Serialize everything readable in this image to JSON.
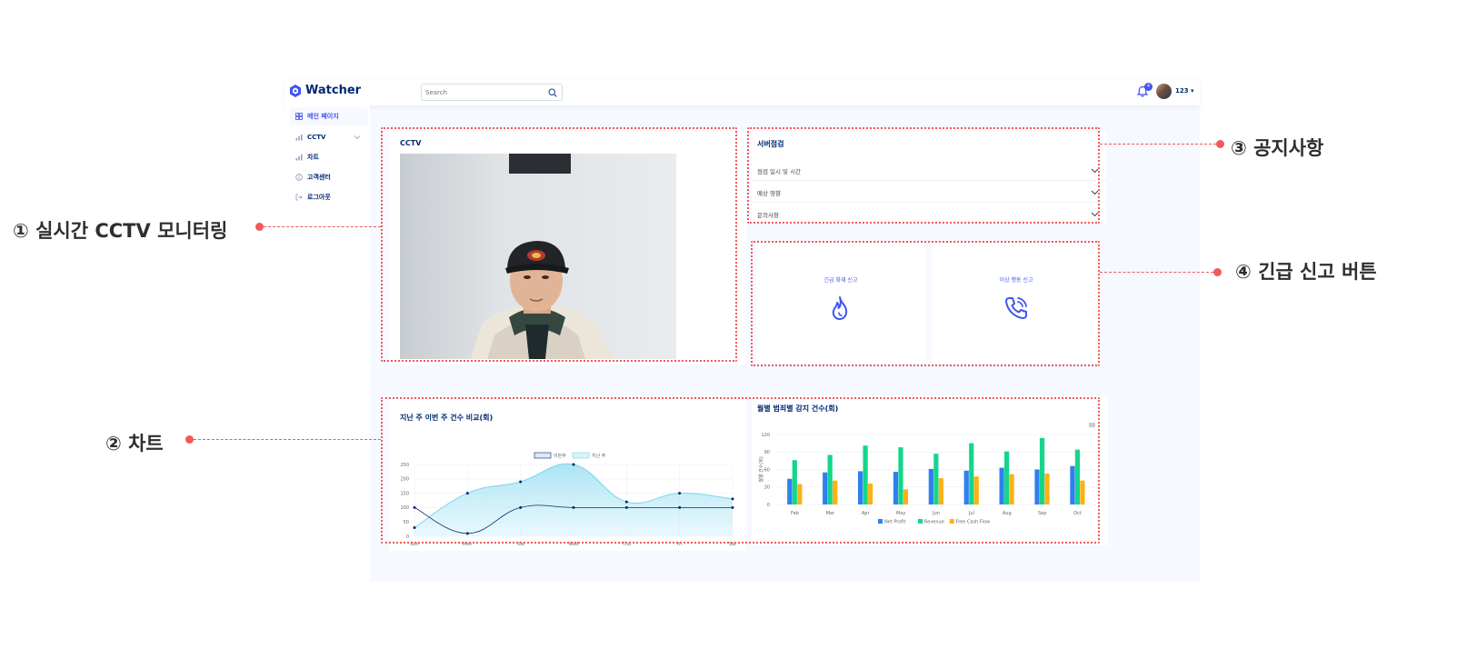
{
  "app": {
    "name": "Watcher",
    "search_placeholder": "Search",
    "notification_count": "4",
    "user_name": "123 ▾"
  },
  "sidebar": {
    "items": [
      {
        "label": "메인 페이지",
        "icon": "grid-icon",
        "active": true
      },
      {
        "label": "CCTV",
        "icon": "bar-chart-icon",
        "expandable": true
      },
      {
        "label": "차트",
        "icon": "bar-chart-icon"
      },
      {
        "label": "고객센터",
        "icon": "info-circle-icon"
      },
      {
        "label": "로그아웃",
        "icon": "logout-icon"
      }
    ]
  },
  "cctv": {
    "title": "CCTV"
  },
  "notice": {
    "title": "서버점검",
    "items": [
      "점검 일시 및 시간",
      "예상 영향",
      "문의사항"
    ]
  },
  "emergency": {
    "fire_label": "긴급 화재 신고",
    "abnormal_label": "이상 행동 신고",
    "fire_icon": "fire-icon",
    "abnormal_icon": "phone-call-icon"
  },
  "line_chart": {
    "title": "지난 주 이번 주 건수 비교(회)"
  },
  "bar_chart": {
    "title": "월별 범죄별 감지 건수(회)"
  },
  "chart_data": [
    {
      "type": "area",
      "title": "지난 주 이번 주 건수 비교(회)",
      "categories": [
        "Sun",
        "Mon",
        "Tue",
        "Wed",
        "Thu",
        "Fri",
        "Sat"
      ],
      "series": [
        {
          "name": "이번주",
          "values": [
            100,
            10,
            100,
            100,
            100,
            100,
            100
          ],
          "color": "#0d2a6b"
        },
        {
          "name": "지난 주",
          "values": [
            30,
            150,
            190,
            250,
            120,
            150,
            130
          ],
          "color": "#7fd3ee"
        }
      ],
      "yticks": [
        0,
        50,
        100,
        150,
        200,
        250
      ],
      "ylim": [
        0,
        250
      ],
      "legend": "top-center",
      "grid": true
    },
    {
      "type": "bar",
      "title": "월별 범죄별 감지 건수(회)",
      "categories": [
        "Feb",
        "Mar",
        "Apr",
        "May",
        "Jun",
        "Jul",
        "Aug",
        "Sep",
        "Oct"
      ],
      "series": [
        {
          "name": "Net Profit",
          "values": [
            44,
            55,
            57,
            56,
            61,
            58,
            63,
            60,
            66
          ],
          "color": "#2e7ff0"
        },
        {
          "name": "Revenue",
          "values": [
            76,
            85,
            101,
            98,
            87,
            105,
            91,
            114,
            94
          ],
          "color": "#14d68a"
        },
        {
          "name": "Free Cash Flow",
          "values": [
            35,
            41,
            36,
            26,
            45,
            48,
            52,
            53,
            41
          ],
          "color": "#fbb117"
        }
      ],
      "ylabel": "월별 건수(회)",
      "yticks": [
        0,
        30,
        60,
        90,
        120
      ],
      "ylim": [
        0,
        120
      ],
      "legend": "bottom-center",
      "grid": true
    }
  ],
  "annotations": [
    {
      "label": "① 실시간 CCTV 모니터링"
    },
    {
      "label": "② 차트"
    },
    {
      "label": "③ 공지사항"
    },
    {
      "label": "④ 긴급 신고 버튼"
    }
  ]
}
